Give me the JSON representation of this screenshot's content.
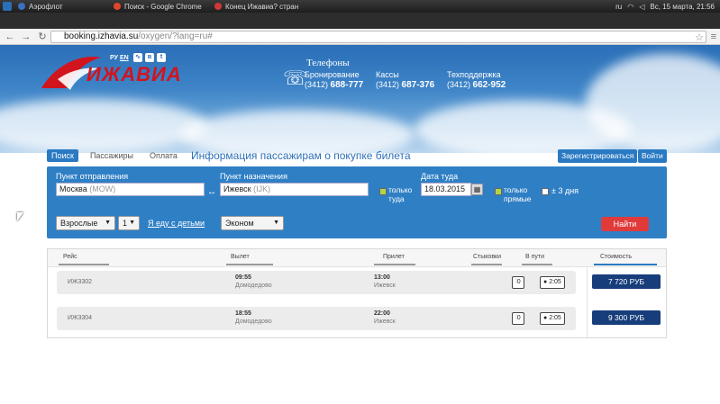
{
  "taskbar": {
    "tabs": [
      {
        "label": "Аэрофлот",
        "color": "#3b6fbf"
      },
      {
        "label": "Поиск - Google Chrome",
        "color": "#e0462c"
      },
      {
        "label": "Конец Ижавиа? стран",
        "color": "#d13838"
      }
    ],
    "lang": "ru",
    "datetime": "Вс, 15 марта, 21:56"
  },
  "browser": {
    "tabs": [
      {
        "label": "Поиск"
      },
      {
        "label": "Конец Ижавиа? стран"
      }
    ],
    "url_host": "booking.izhavia.su",
    "url_path": "/oxygen/?lang=ru#"
  },
  "header": {
    "logo_text": "ИЖАВИА",
    "lang_ru": "РУ",
    "lang_en": "EN",
    "phones_title": "Телефоны",
    "phones": [
      {
        "label": "Бронирование",
        "number_prefix": "(3412)",
        "number": "688-777"
      },
      {
        "label": "Кассы",
        "number_prefix": "(3412)",
        "number": "687-376"
      },
      {
        "label": "Техподдержка",
        "number_prefix": "(3412)",
        "number": "662-952"
      }
    ]
  },
  "steps": {
    "search": "Поиск",
    "passengers": "Пассажиры",
    "payment": "Оплата",
    "info": "Информация пассажирам о покупке билета"
  },
  "auth": {
    "register": "Зарегистрироваться",
    "login": "Войти"
  },
  "search": {
    "from_label": "Пункт отправления",
    "from_city": "Москва",
    "from_code": "(MOW)",
    "to_label": "Пункт назначения",
    "to_city": "Ижевск",
    "to_code": "(IJK)",
    "one_way": "только туда",
    "date_label": "Дата туда",
    "date_value": "18.03.2015",
    "direct_only": "только прямые",
    "plus_minus": "± 3 дня",
    "passenger_type": "Взрослые",
    "passenger_count": "1",
    "with_children": "Я еду с детьми",
    "class": "Эконом",
    "find": "Найти"
  },
  "results": {
    "headers": {
      "flight": "Рейс",
      "departure": "Вылет",
      "arrival": "Прилет",
      "connections": "Стыковки",
      "duration": "В пути",
      "price": "Стоимость"
    },
    "rows": [
      {
        "flight": "ИЖ3302",
        "dep_time": "09:55",
        "dep_place": "Домодедово",
        "arr_time": "13:00",
        "arr_place": "Ижевск",
        "stops": "0",
        "duration": "2:05",
        "price": "7 720 РУБ"
      },
      {
        "flight": "ИЖ3304",
        "dep_time": "18:55",
        "dep_place": "Домодедово",
        "arr_time": "22:00",
        "arr_place": "Ижевск",
        "stops": "0",
        "duration": "2:05",
        "price": "9 300 РУБ"
      }
    ]
  }
}
